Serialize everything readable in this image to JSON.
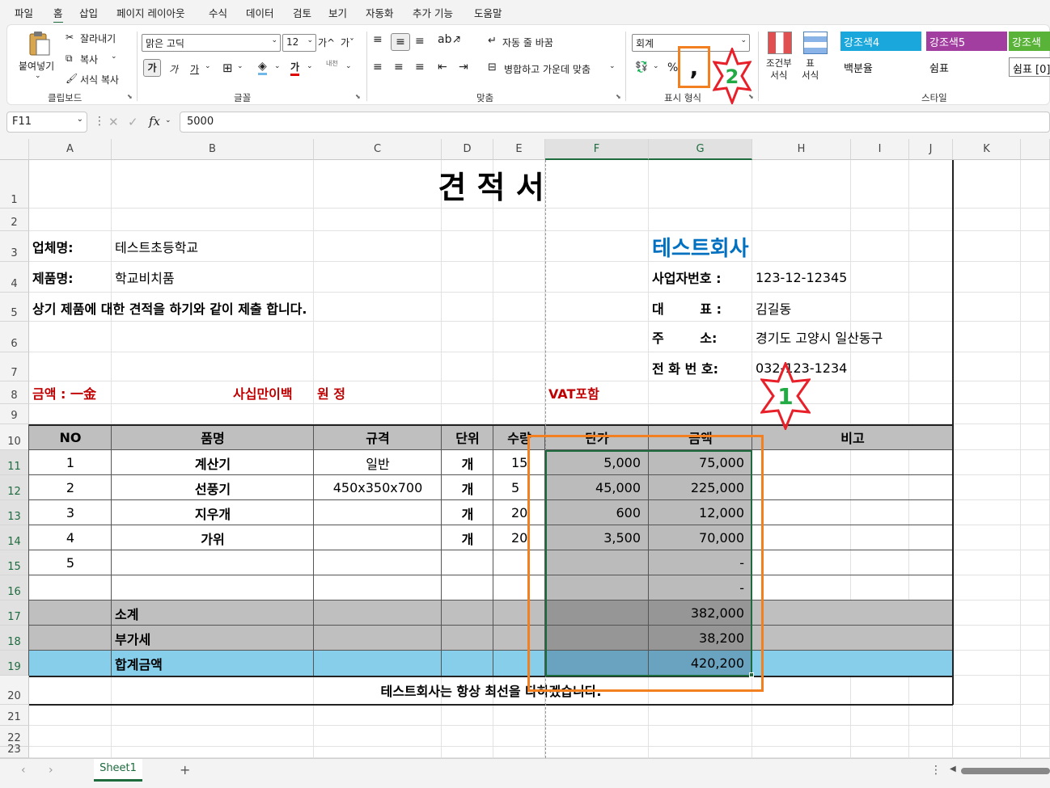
{
  "menu": [
    "파일",
    "홈",
    "삽입",
    "페이지 레이아웃",
    "수식",
    "데이터",
    "검토",
    "보기",
    "자동화",
    "추가 기능",
    "도움말"
  ],
  "active_menu": "홈",
  "ribbon": {
    "clipboard": {
      "paste": "붙여넣기",
      "cut": "잘라내기",
      "copy": "복사",
      "format_painter": "서식 복사",
      "group": "클립보드"
    },
    "font": {
      "name": "맑은 고딕",
      "size": "12",
      "bold": "가",
      "italic": "가",
      "underline": "가",
      "grow": "가^",
      "shrink": "가ˇ",
      "color_glyph": "가",
      "phonetic": "내천",
      "group": "글꼴"
    },
    "align": {
      "wrap": "자동 줄 바꿈",
      "merge": "병합하고 가운데 맞춤",
      "group": "맞춤"
    },
    "number": {
      "format": "회계",
      "percent": "%",
      "comma": ",",
      "group": "표시 형식"
    },
    "styles": {
      "conditional": "조건부\n서식",
      "table": "표\n서식",
      "cells": [
        {
          "label": "강조색4",
          "bg": "#1aa7db"
        },
        {
          "label": "강조색5",
          "bg": "#a23ea0"
        },
        {
          "label": "강조색",
          "bg": "#59b339"
        },
        {
          "label": "백분율",
          "bg": "#ffffff"
        },
        {
          "label": "쉼표",
          "bg": "#ffffff"
        },
        {
          "label": "쉼표 [0]",
          "bg": "#ffffff"
        }
      ],
      "group": "스타일"
    }
  },
  "formula_bar": {
    "name_box": "F11",
    "fx": "fx",
    "value": "5000"
  },
  "columns": [
    "A",
    "B",
    "C",
    "D",
    "E",
    "F",
    "G",
    "H",
    "I",
    "J",
    "K"
  ],
  "rows": [
    "1",
    "2",
    "3",
    "4",
    "5",
    "6",
    "7",
    "8",
    "9",
    "10",
    "11",
    "12",
    "13",
    "14",
    "15",
    "16",
    "17",
    "18",
    "19",
    "20",
    "21",
    "22",
    "23"
  ],
  "sheet": {
    "title": "견 적 서",
    "company_label": "업체명:",
    "company": "테스트초등학교",
    "product_label": "제품명:",
    "product": "학교비치품",
    "intro": "상기 제품에 대한 견적을 하기와 같이 제출 합니다.",
    "vendor": "테스트회사",
    "biz_no_label": "사업자번호 :",
    "biz_no": "123-12-12345",
    "ceo_label": "대        표 :",
    "ceo": "김길동",
    "addr_label": "주        소:",
    "addr": "경기도 고양시 일산동구",
    "tel_label": "전 화 번 호:",
    "tel": "032-123-1234",
    "amount_label": "금액 : 一金",
    "amount_words": "사십만이백",
    "amount_won": "원 정",
    "vat_note": "VAT포함",
    "headers": [
      "NO",
      "품명",
      "규격",
      "단위",
      "수량",
      "단가",
      "금액",
      "비고"
    ],
    "items": [
      {
        "no": "1",
        "name": "계산기",
        "spec": "일반",
        "unit": "개",
        "qty": "15",
        "price": "5,000",
        "amount": "75,000"
      },
      {
        "no": "2",
        "name": "선풍기",
        "spec": "450x350x700",
        "unit": "개",
        "qty": "5",
        "price": "45,000",
        "amount": "225,000"
      },
      {
        "no": "3",
        "name": "지우개",
        "spec": "",
        "unit": "개",
        "qty": "20",
        "price": "600",
        "amount": "12,000"
      },
      {
        "no": "4",
        "name": "가위",
        "spec": "",
        "unit": "개",
        "qty": "20",
        "price": "3,500",
        "amount": "70,000"
      },
      {
        "no": "5",
        "name": "",
        "spec": "",
        "unit": "",
        "qty": "",
        "price": "",
        "amount": "-"
      },
      {
        "no": "",
        "name": "",
        "spec": "",
        "unit": "",
        "qty": "",
        "price": "",
        "amount": "-"
      }
    ],
    "subtotal_label": "소계",
    "subtotal": "382,000",
    "vat_label": "부가세",
    "vat": "38,200",
    "total_label": "합계금액",
    "total": "420,200",
    "footer": "테스트회사는 항상 최선을 다하겠습니다."
  },
  "annotations": {
    "star1": "1",
    "star2": "2"
  },
  "sheet_tab": "Sheet1",
  "colors": {
    "accent_green": "#1e6b3e",
    "header_gray": "#bfbfbf",
    "dark_gray": "#969696",
    "total_blue": "#87ceeb",
    "red_text": "#c00000",
    "vendor_blue": "#0070c0",
    "orange": "#f28020",
    "star_red": "#e8202a",
    "star_green": "#22aa44"
  }
}
